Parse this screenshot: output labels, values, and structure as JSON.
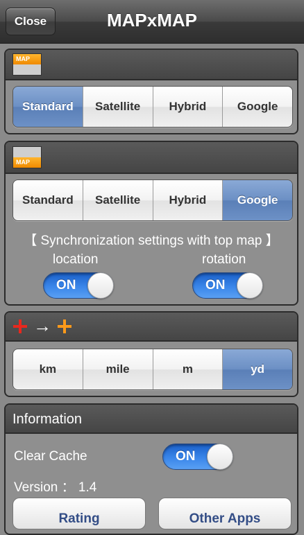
{
  "navbar": {
    "title": "MAPxMAP",
    "close_label": "Close"
  },
  "top_map": {
    "icon_label": "MAP",
    "map_types": [
      "Standard",
      "Satellite",
      "Hybrid",
      "Google"
    ],
    "selected": "Standard"
  },
  "bottom_map": {
    "icon_label": "MAP",
    "map_types": [
      "Standard",
      "Satellite",
      "Hybrid",
      "Google"
    ],
    "selected": "Google",
    "sync_title": "【 Synchronization settings with top map 】",
    "location_label": "location",
    "location_state": "ON",
    "rotation_label": "rotation",
    "rotation_state": "ON"
  },
  "distance": {
    "arrow": "→",
    "units": [
      "km",
      "mile",
      "m",
      "yd"
    ],
    "selected": "yd",
    "colors": {
      "start": "#e8281e",
      "end": "#ff9a1a"
    }
  },
  "information": {
    "title": "Information",
    "clear_cache_label": "Clear Cache",
    "clear_cache_state": "ON",
    "version_label": "Version ： 1.4",
    "rating_label": "Rating",
    "other_apps_label": "Other Apps"
  }
}
